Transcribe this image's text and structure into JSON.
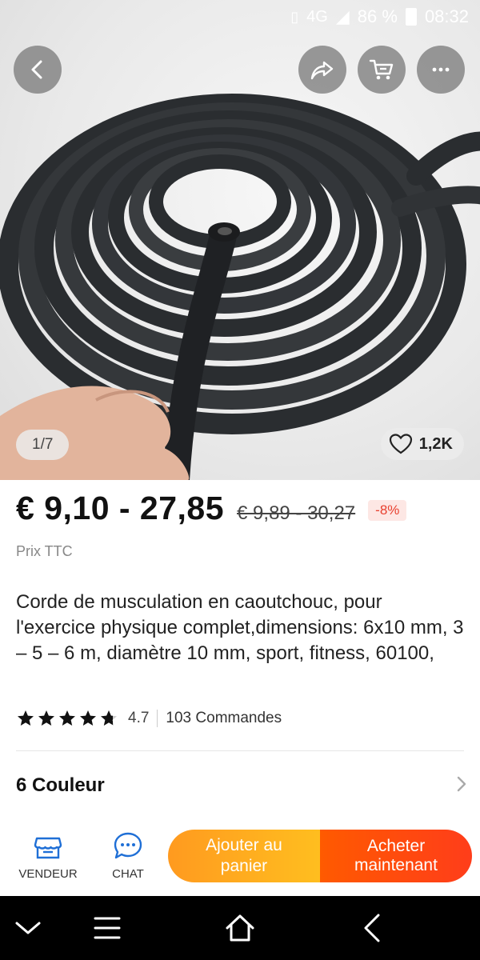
{
  "status_bar": {
    "network": "4G",
    "network_super": "4G",
    "battery": "86 %",
    "time": "08:32"
  },
  "gallery": {
    "pager": "1/7",
    "likes": "1,2K"
  },
  "price": {
    "current": "€ 9,10 - 27,85",
    "original": "€ 9,89 - 30,27",
    "discount": "-8%",
    "tax_note": "Prix TTC"
  },
  "product": {
    "title": "Corde de musculation en caoutchouc, pour l'exercice physique complet,dimensions: 6x10 mm, 3 – 5 – 6 m, diamètre 10 mm, sport, fitness, 60100,",
    "rating": "4.7",
    "rating_fraction": 0.94,
    "orders": "103 Commandes"
  },
  "variants": {
    "label": "6 Couleur"
  },
  "action_bar": {
    "vendeur": "VENDEUR",
    "chat": "CHAT",
    "add_to_cart": "Ajouter au panier",
    "buy_now": "Acheter maintenant"
  },
  "colors": {
    "cta_add": "#ffa51f",
    "cta_buy": "#ff4a0f",
    "discount": "#e8402f",
    "icon_blue": "#1f6fd6"
  },
  "icons": {
    "back": "chevron-left-icon",
    "share": "share-icon",
    "cart": "cart-icon",
    "more": "more-icon",
    "heart": "heart-icon",
    "vendeur": "store-icon",
    "chat": "chat-icon"
  }
}
